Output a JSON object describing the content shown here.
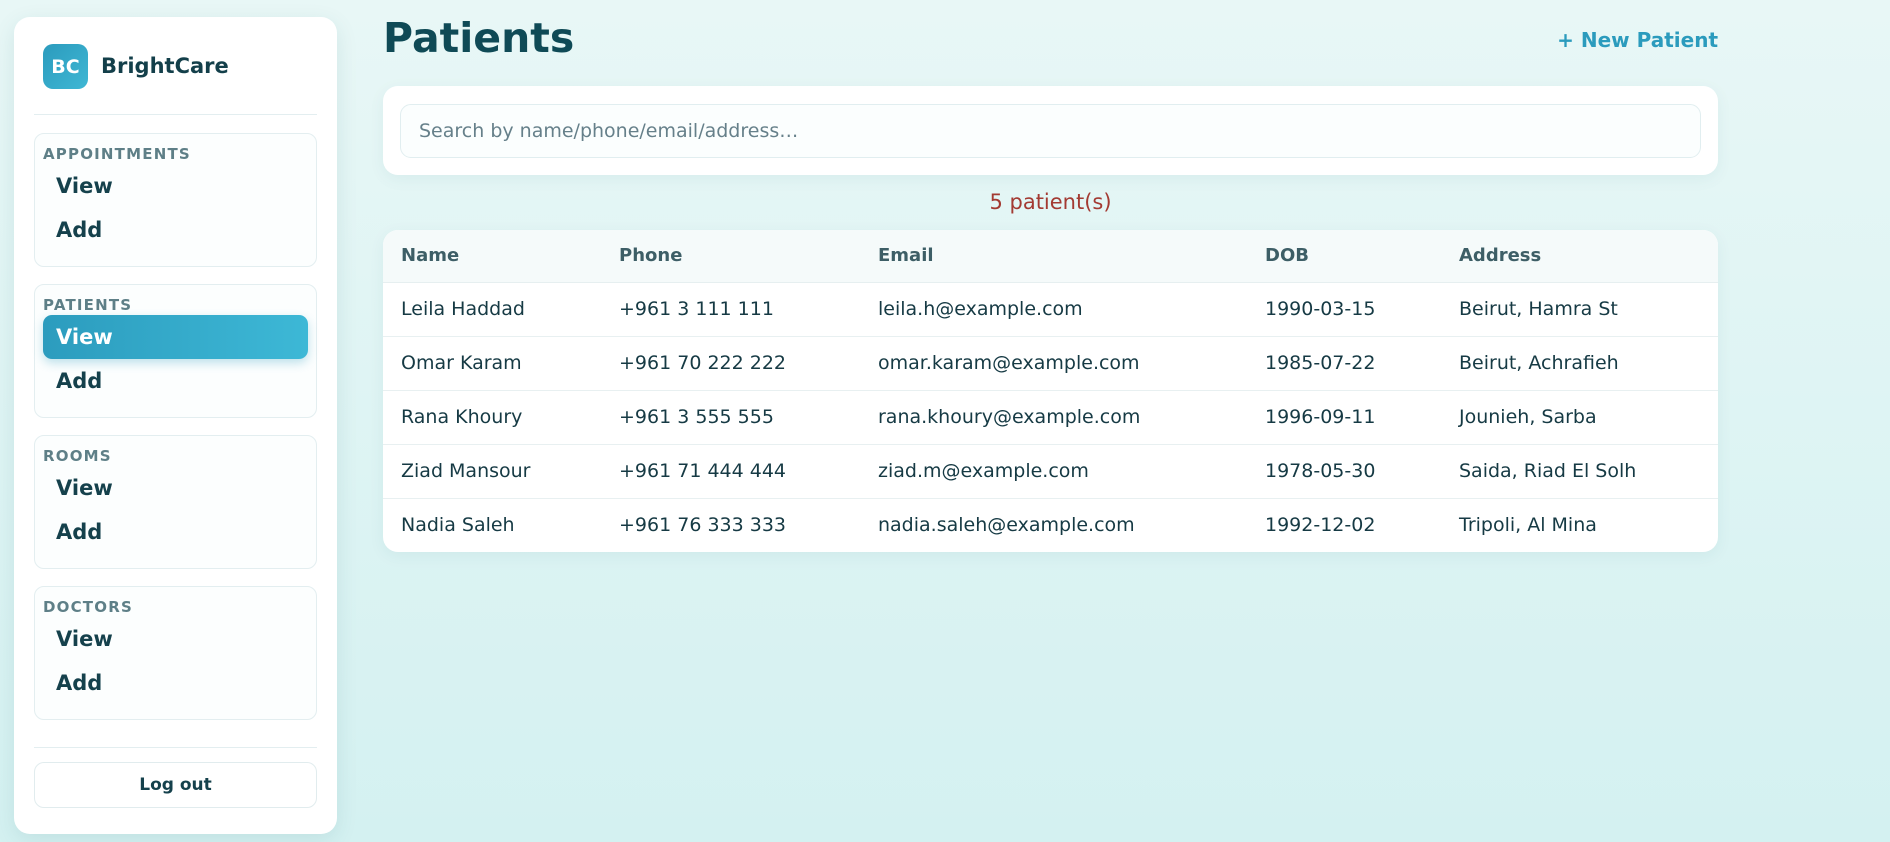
{
  "brand": {
    "logo": "BC",
    "name": "BrightCare"
  },
  "sidebar": {
    "groups": [
      {
        "title": "APPOINTMENTS",
        "items": [
          {
            "label": "View"
          },
          {
            "label": "Add"
          }
        ]
      },
      {
        "title": "PATIENTS",
        "items": [
          {
            "label": "View",
            "active": true
          },
          {
            "label": "Add"
          }
        ]
      },
      {
        "title": "ROOMS",
        "items": [
          {
            "label": "View"
          },
          {
            "label": "Add"
          }
        ]
      },
      {
        "title": "DOCTORS",
        "items": [
          {
            "label": "View"
          },
          {
            "label": "Add"
          }
        ]
      }
    ],
    "logout_label": "Log out"
  },
  "main": {
    "title": "Patients",
    "new_button": "+ New Patient",
    "search": {
      "placeholder": "Search by name/phone/email/address…",
      "value": ""
    },
    "count_text": "5 patient(s)",
    "table": {
      "columns": [
        "Name",
        "Phone",
        "Email",
        "DOB",
        "Address"
      ],
      "rows": [
        [
          "Leila Haddad",
          "+961 3 111 111",
          "leila.h@example.com",
          "1990-03-15",
          "Beirut, Hamra St"
        ],
        [
          "Omar Karam",
          "+961 70 222 222",
          "omar.karam@example.com",
          "1985-07-22",
          "Beirut, Achrafieh"
        ],
        [
          "Rana Khoury",
          "+961 3 555 555",
          "rana.khoury@example.com",
          "1996-09-11",
          "Jounieh, Sarba"
        ],
        [
          "Ziad Mansour",
          "+961 71 444 444",
          "ziad.m@example.com",
          "1978-05-30",
          "Saida, Riad El Solh"
        ],
        [
          "Nadia Saleh",
          "+961 76 333 333",
          "nadia.saleh@example.com",
          "1992-12-02",
          "Tripoli, Al Mina"
        ]
      ]
    }
  },
  "colors": {
    "accent": "#2b9bbd",
    "title": "#0f4a56",
    "count": "#a33a32",
    "background": "#d9f2f1"
  }
}
